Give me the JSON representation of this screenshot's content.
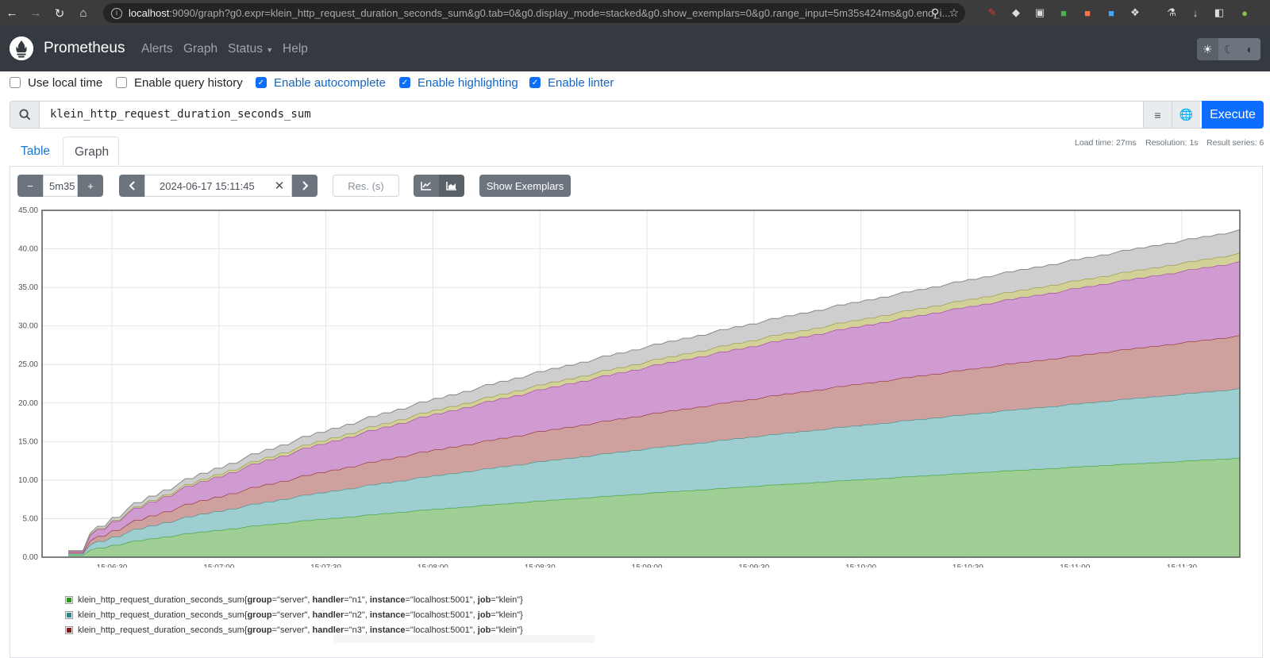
{
  "browser": {
    "url_host": "localhost",
    "url_rest": ":9090/graph?g0.expr=klein_http_request_duration_seconds_sum&g0.tab=0&g0.display_mode=stacked&g0.show_exemplars=0&g0.range_input=5m35s424ms&g0.end_i..."
  },
  "navbar": {
    "brand": "Prometheus",
    "links": [
      "Alerts",
      "Graph",
      "Status",
      "Help"
    ]
  },
  "options": [
    {
      "label": "Use local time",
      "checked": false
    },
    {
      "label": "Enable query history",
      "checked": false
    },
    {
      "label": "Enable autocomplete",
      "checked": true
    },
    {
      "label": "Enable highlighting",
      "checked": true
    },
    {
      "label": "Enable linter",
      "checked": true
    }
  ],
  "query": {
    "expression": "klein_http_request_duration_seconds_sum",
    "execute_label": "Execute"
  },
  "tabs": {
    "table": "Table",
    "graph": "Graph"
  },
  "stats": {
    "load_time": "Load time: 27ms",
    "resolution": "Resolution: 1s",
    "result_series": "Result series: 6"
  },
  "graph_controls": {
    "range": "5m35",
    "end_time": "2024-06-17 15:11:45",
    "res_placeholder": "Res. (s)",
    "show_exemplars": "Show Exemplars"
  },
  "chart_data": {
    "type": "area",
    "stacked": true,
    "ylim": [
      0,
      45
    ],
    "y_ticks": [
      "0.00",
      "5.00",
      "10.00",
      "15.00",
      "20.00",
      "25.00",
      "30.00",
      "35.00",
      "40.00",
      "45.00"
    ],
    "x_ticks": [
      "15:06:30",
      "15:07:00",
      "15:07:30",
      "15:08:00",
      "15:08:30",
      "15:09:00",
      "15:09:30",
      "15:10:00",
      "15:10:30",
      "15:11:00",
      "15:11:30"
    ],
    "grid": true,
    "series": [
      {
        "name": "klein_http_request_duration_seconds_sum{group=\"server\", handler=\"n1\", instance=\"localhost:5001\", job=\"klein\"}",
        "color": "#2a9a1d",
        "fill": "#9bcc8f",
        "end_value": 12.9
      },
      {
        "name": "klein_http_request_duration_seconds_sum{group=\"server\", handler=\"n2\", instance=\"localhost:5001\", job=\"klein\"}",
        "color": "#2b8a8c",
        "fill": "#99cbcc",
        "end_value": 9.0
      },
      {
        "name": "klein_http_request_duration_seconds_sum{group=\"server\", handler=\"n3\", instance=\"localhost:5001\", job=\"klein\"}",
        "color": "#8b1a1a",
        "fill": "#cc9c99",
        "end_value": 6.9
      },
      {
        "name": "",
        "color": "#9c2aa6",
        "fill": "#cd96cf",
        "end_value": 9.6
      },
      {
        "name": "",
        "color": "#8a8a30",
        "fill": "#cfcf92",
        "end_value": 1.1
      },
      {
        "name": "",
        "color": "#888888",
        "fill": "#cbcbcb",
        "end_value": 3.0
      }
    ]
  },
  "legend": [
    {
      "metric": "klein_http_request_duration_seconds_sum{",
      "group": "\"server\"",
      "handler": "\"n1\"",
      "instance": "\"localhost:5001\"",
      "job": "\"klein\"",
      "color": "#2a9a1d"
    },
    {
      "metric": "klein_http_request_duration_seconds_sum{",
      "group": "\"server\"",
      "handler": "\"n2\"",
      "instance": "\"localhost:5001\"",
      "job": "\"klein\"",
      "color": "#2b8a8c"
    },
    {
      "metric": "klein_http_request_duration_seconds_sum{",
      "group": "\"server\"",
      "handler": "\"n3\"",
      "instance": "\"localhost:5001\"",
      "job": "\"klein\"",
      "color": "#8b1a1a"
    }
  ]
}
